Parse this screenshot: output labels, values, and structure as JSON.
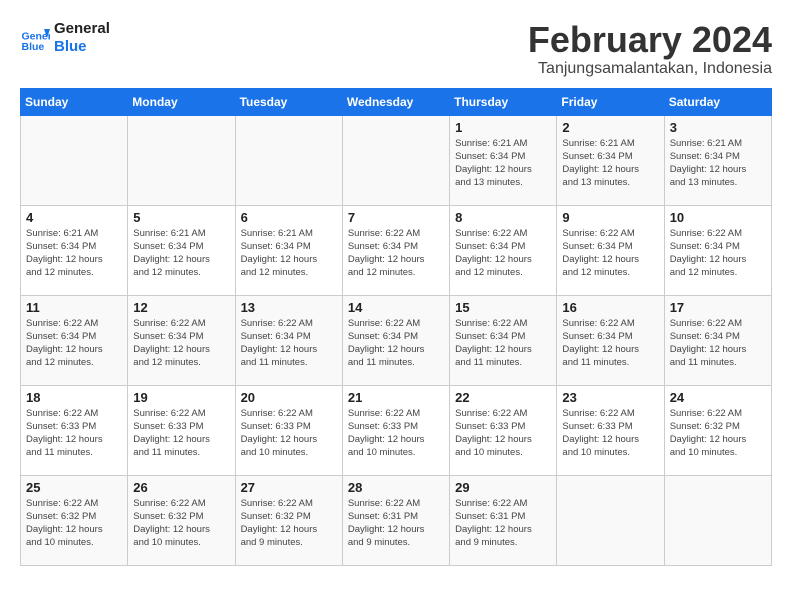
{
  "header": {
    "logo_line1": "General",
    "logo_line2": "Blue",
    "month": "February 2024",
    "location": "Tanjungsamalantakan, Indonesia"
  },
  "days_of_week": [
    "Sunday",
    "Monday",
    "Tuesday",
    "Wednesday",
    "Thursday",
    "Friday",
    "Saturday"
  ],
  "weeks": [
    [
      {
        "num": "",
        "info": ""
      },
      {
        "num": "",
        "info": ""
      },
      {
        "num": "",
        "info": ""
      },
      {
        "num": "",
        "info": ""
      },
      {
        "num": "1",
        "info": "Sunrise: 6:21 AM\nSunset: 6:34 PM\nDaylight: 12 hours\nand 13 minutes."
      },
      {
        "num": "2",
        "info": "Sunrise: 6:21 AM\nSunset: 6:34 PM\nDaylight: 12 hours\nand 13 minutes."
      },
      {
        "num": "3",
        "info": "Sunrise: 6:21 AM\nSunset: 6:34 PM\nDaylight: 12 hours\nand 13 minutes."
      }
    ],
    [
      {
        "num": "4",
        "info": "Sunrise: 6:21 AM\nSunset: 6:34 PM\nDaylight: 12 hours\nand 12 minutes."
      },
      {
        "num": "5",
        "info": "Sunrise: 6:21 AM\nSunset: 6:34 PM\nDaylight: 12 hours\nand 12 minutes."
      },
      {
        "num": "6",
        "info": "Sunrise: 6:21 AM\nSunset: 6:34 PM\nDaylight: 12 hours\nand 12 minutes."
      },
      {
        "num": "7",
        "info": "Sunrise: 6:22 AM\nSunset: 6:34 PM\nDaylight: 12 hours\nand 12 minutes."
      },
      {
        "num": "8",
        "info": "Sunrise: 6:22 AM\nSunset: 6:34 PM\nDaylight: 12 hours\nand 12 minutes."
      },
      {
        "num": "9",
        "info": "Sunrise: 6:22 AM\nSunset: 6:34 PM\nDaylight: 12 hours\nand 12 minutes."
      },
      {
        "num": "10",
        "info": "Sunrise: 6:22 AM\nSunset: 6:34 PM\nDaylight: 12 hours\nand 12 minutes."
      }
    ],
    [
      {
        "num": "11",
        "info": "Sunrise: 6:22 AM\nSunset: 6:34 PM\nDaylight: 12 hours\nand 12 minutes."
      },
      {
        "num": "12",
        "info": "Sunrise: 6:22 AM\nSunset: 6:34 PM\nDaylight: 12 hours\nand 12 minutes."
      },
      {
        "num": "13",
        "info": "Sunrise: 6:22 AM\nSunset: 6:34 PM\nDaylight: 12 hours\nand 11 minutes."
      },
      {
        "num": "14",
        "info": "Sunrise: 6:22 AM\nSunset: 6:34 PM\nDaylight: 12 hours\nand 11 minutes."
      },
      {
        "num": "15",
        "info": "Sunrise: 6:22 AM\nSunset: 6:34 PM\nDaylight: 12 hours\nand 11 minutes."
      },
      {
        "num": "16",
        "info": "Sunrise: 6:22 AM\nSunset: 6:34 PM\nDaylight: 12 hours\nand 11 minutes."
      },
      {
        "num": "17",
        "info": "Sunrise: 6:22 AM\nSunset: 6:34 PM\nDaylight: 12 hours\nand 11 minutes."
      }
    ],
    [
      {
        "num": "18",
        "info": "Sunrise: 6:22 AM\nSunset: 6:33 PM\nDaylight: 12 hours\nand 11 minutes."
      },
      {
        "num": "19",
        "info": "Sunrise: 6:22 AM\nSunset: 6:33 PM\nDaylight: 12 hours\nand 11 minutes."
      },
      {
        "num": "20",
        "info": "Sunrise: 6:22 AM\nSunset: 6:33 PM\nDaylight: 12 hours\nand 10 minutes."
      },
      {
        "num": "21",
        "info": "Sunrise: 6:22 AM\nSunset: 6:33 PM\nDaylight: 12 hours\nand 10 minutes."
      },
      {
        "num": "22",
        "info": "Sunrise: 6:22 AM\nSunset: 6:33 PM\nDaylight: 12 hours\nand 10 minutes."
      },
      {
        "num": "23",
        "info": "Sunrise: 6:22 AM\nSunset: 6:33 PM\nDaylight: 12 hours\nand 10 minutes."
      },
      {
        "num": "24",
        "info": "Sunrise: 6:22 AM\nSunset: 6:32 PM\nDaylight: 12 hours\nand 10 minutes."
      }
    ],
    [
      {
        "num": "25",
        "info": "Sunrise: 6:22 AM\nSunset: 6:32 PM\nDaylight: 12 hours\nand 10 minutes."
      },
      {
        "num": "26",
        "info": "Sunrise: 6:22 AM\nSunset: 6:32 PM\nDaylight: 12 hours\nand 10 minutes."
      },
      {
        "num": "27",
        "info": "Sunrise: 6:22 AM\nSunset: 6:32 PM\nDaylight: 12 hours\nand 9 minutes."
      },
      {
        "num": "28",
        "info": "Sunrise: 6:22 AM\nSunset: 6:31 PM\nDaylight: 12 hours\nand 9 minutes."
      },
      {
        "num": "29",
        "info": "Sunrise: 6:22 AM\nSunset: 6:31 PM\nDaylight: 12 hours\nand 9 minutes."
      },
      {
        "num": "",
        "info": ""
      },
      {
        "num": "",
        "info": ""
      }
    ]
  ]
}
